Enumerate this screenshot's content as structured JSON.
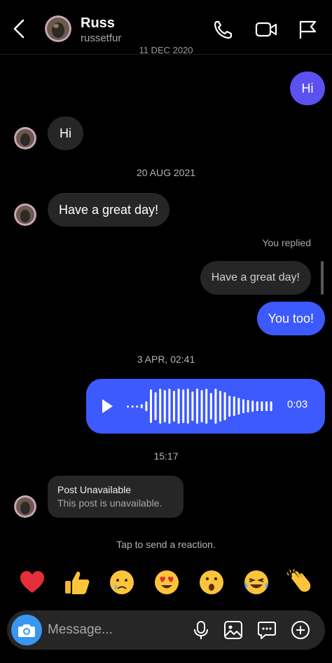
{
  "header": {
    "name": "Russ",
    "username": "russetfur",
    "clipped_date": "11 DEC 2020"
  },
  "thread": {
    "msg_out_hi": "Hi",
    "msg_in_hi": "Hi",
    "date_aug": "20 AUG 2021",
    "msg_in_greeting": "Have a great day!",
    "you_replied": "You replied",
    "reply_quote": "Have a great day!",
    "msg_out_reply": "You too!",
    "date_apr": "3 APR, 02:41",
    "voice_duration": "0:03",
    "time_1517": "15:17",
    "post_title": "Post Unavailable",
    "post_subtitle": "This post is unavailable.",
    "tap_hint": "Tap to send a reaction."
  },
  "reactions": [
    "❤️",
    "👍",
    "😢",
    "😍",
    "😮",
    "😂",
    "👏"
  ],
  "composer": {
    "placeholder": "Message..."
  },
  "colors": {
    "background": "#000000",
    "incoming_bubble": "#262626",
    "outgoing_bubble": "#3d5afe",
    "camera_button": "#3897f0"
  },
  "icons": [
    "back-icon",
    "phone-icon",
    "video-icon",
    "flag-icon",
    "play-icon",
    "camera-icon",
    "microphone-icon",
    "image-icon",
    "sticker-icon",
    "plus-icon"
  ]
}
